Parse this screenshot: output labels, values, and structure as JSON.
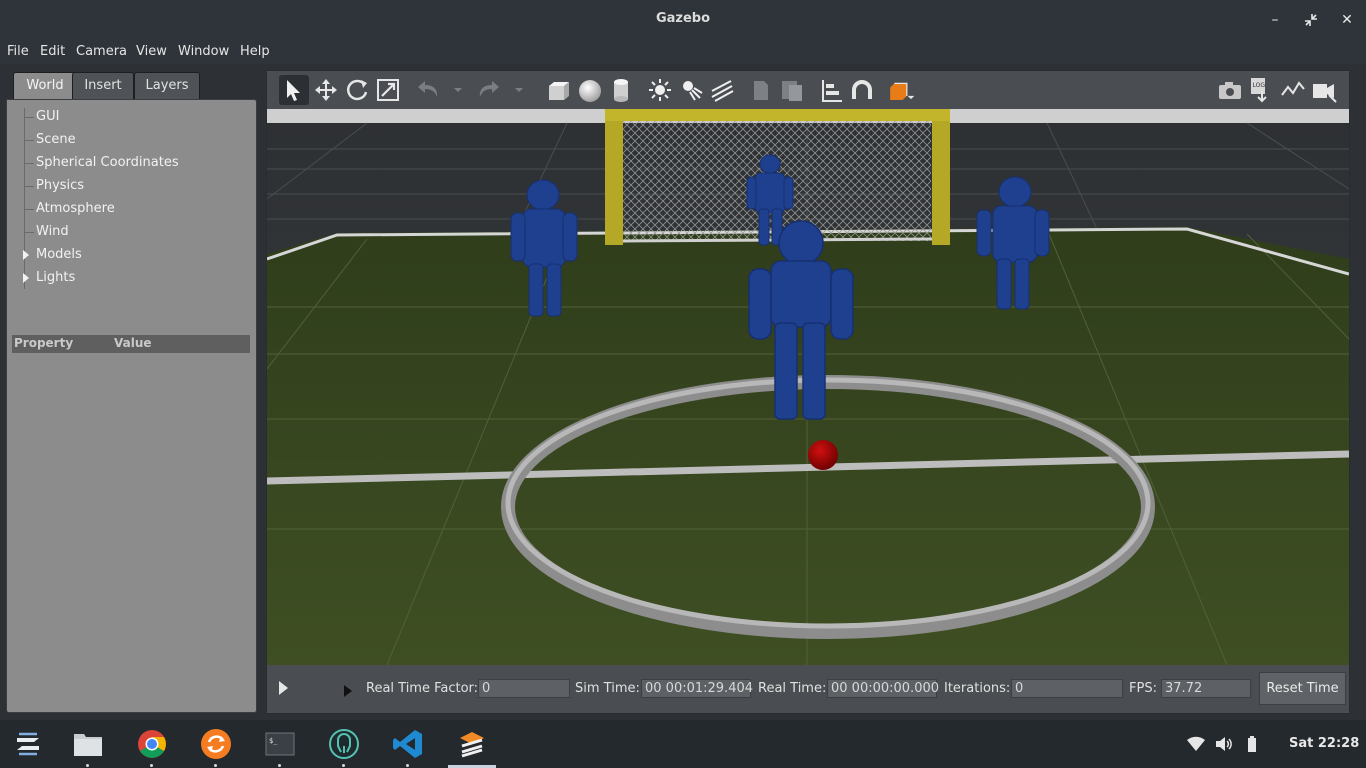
{
  "window": {
    "title": "Gazebo"
  },
  "menu": [
    "File",
    "Edit",
    "Camera",
    "View",
    "Window",
    "Help"
  ],
  "left_tabs": [
    "World",
    "Insert",
    "Layers"
  ],
  "tree_items": [
    {
      "label": "GUI",
      "expandable": false
    },
    {
      "label": "Scene",
      "expandable": false
    },
    {
      "label": "Spherical Coordinates",
      "expandable": false
    },
    {
      "label": "Physics",
      "expandable": false
    },
    {
      "label": "Atmosphere",
      "expandable": false
    },
    {
      "label": "Wind",
      "expandable": false
    },
    {
      "label": "Models",
      "expandable": true
    },
    {
      "label": "Lights",
      "expandable": true
    }
  ],
  "property_table": {
    "col_property": "Property",
    "col_value": "Value"
  },
  "toolbar_icons": [
    "select-arrow-icon",
    "translate-icon",
    "rotate-icon",
    "scale-icon",
    "undo-icon",
    "redo-icon",
    "box-shape-icon",
    "sphere-shape-icon",
    "cylinder-shape-icon",
    "point-light-icon",
    "spot-light-icon",
    "directional-light-icon",
    "copy-icon",
    "paste-icon",
    "align-icon",
    "snap-icon",
    "view-angle-icon",
    "screenshot-icon",
    "log-icon",
    "plot-icon",
    "video-record-icon"
  ],
  "bottom": {
    "real_time_factor_label": "Real Time Factor:",
    "real_time_factor": "0",
    "sim_time_label": "Sim Time:",
    "sim_time": "00 00:01:29.404",
    "real_time_label": "Real Time:",
    "real_time": "00 00:00:00.000",
    "iterations_label": "Iterations:",
    "iterations": "0",
    "fps_label": "FPS:",
    "fps": "37.72",
    "reset_label": "Reset Time"
  },
  "taskbar": {
    "apps": [
      "zorin-menu-icon",
      "files-icon",
      "chrome-icon",
      "sync-icon",
      "terminal-icon",
      "gitkraken-icon",
      "vscode-icon",
      "gazebo-icon"
    ],
    "clock": "Sat 22:28"
  },
  "colors": {
    "robot": "#1f3f8f",
    "ball": "#a30000",
    "goal": "#b5a826",
    "field": "#3e4d24"
  }
}
